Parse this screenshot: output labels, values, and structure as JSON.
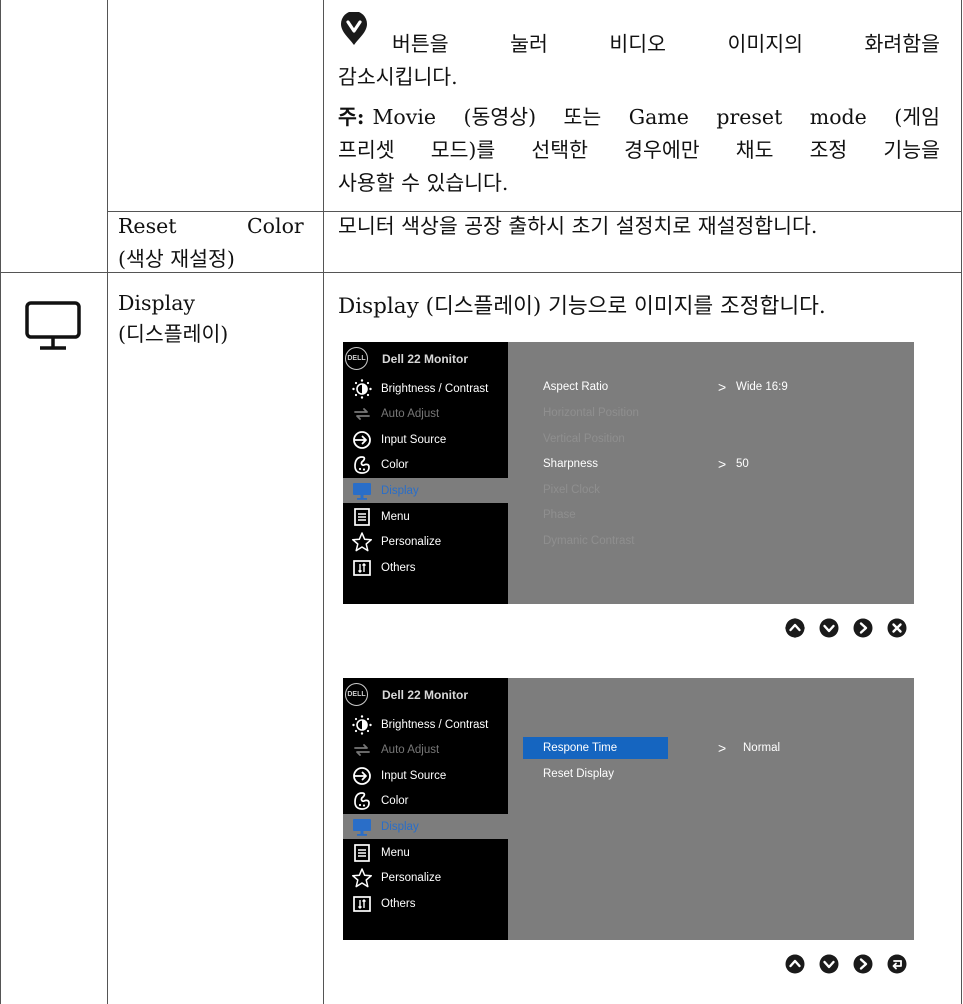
{
  "top_desc": {
    "line1": "버튼을 눌러 비디오 이미지의 화려함을",
    "line2": "감소시킵니다.",
    "note_label": "주:",
    "note_line1": "Movie (동영상) 또는 Game preset mode (게임",
    "note_line2": "프리셋 모드)를 선택한 경우에만 채도 조정 기능을",
    "note_line3": "사용할 수 있습니다."
  },
  "reset_color": {
    "name_line1_a": "Reset",
    "name_line1_b": "Color",
    "name_line2": "(색상 재설정)",
    "desc": "모니터 색상을 공장 출하시 초기 설정치로 재설정합니다."
  },
  "display": {
    "name_line1": "Display",
    "name_line2": "(디스플레이)",
    "desc": "Display (디스플레이) 기능으로 이미지를 조정합니다."
  },
  "osd": {
    "brand_logo": "DELL",
    "title": "Dell 22 Monitor",
    "menu": [
      {
        "label": "Brightness / Contrast",
        "icon": "brightness-icon"
      },
      {
        "label": "Auto Adjust",
        "icon": "auto-adjust-icon"
      },
      {
        "label": "Input Source",
        "icon": "input-source-icon"
      },
      {
        "label": "Color",
        "icon": "color-icon"
      },
      {
        "label": "Display",
        "icon": "display-icon"
      },
      {
        "label": "Menu",
        "icon": "menu-icon"
      },
      {
        "label": "Personalize",
        "icon": "star-icon"
      },
      {
        "label": "Others",
        "icon": "others-icon"
      }
    ],
    "screen1": {
      "options": [
        "Aspect Ratio",
        "Horizontal Position",
        "Vertical Position",
        "Sharpness",
        "Pixel Clock",
        "Phase",
        "Dymanic Contrast"
      ],
      "aspect_value": "Wide 16:9",
      "sharpness_value": "50",
      "arrow": ">"
    },
    "screen2": {
      "options": [
        "Respone Time",
        "Reset Display"
      ],
      "response_value": "Normal",
      "arrow": ">"
    },
    "selected_color": "#1565c0",
    "panel_color": "#7d7d7d"
  },
  "buttons": {
    "row1": [
      "up-icon",
      "down-icon",
      "right-icon",
      "close-icon"
    ],
    "row2": [
      "up-icon",
      "down-icon",
      "right-icon",
      "back-icon"
    ]
  }
}
